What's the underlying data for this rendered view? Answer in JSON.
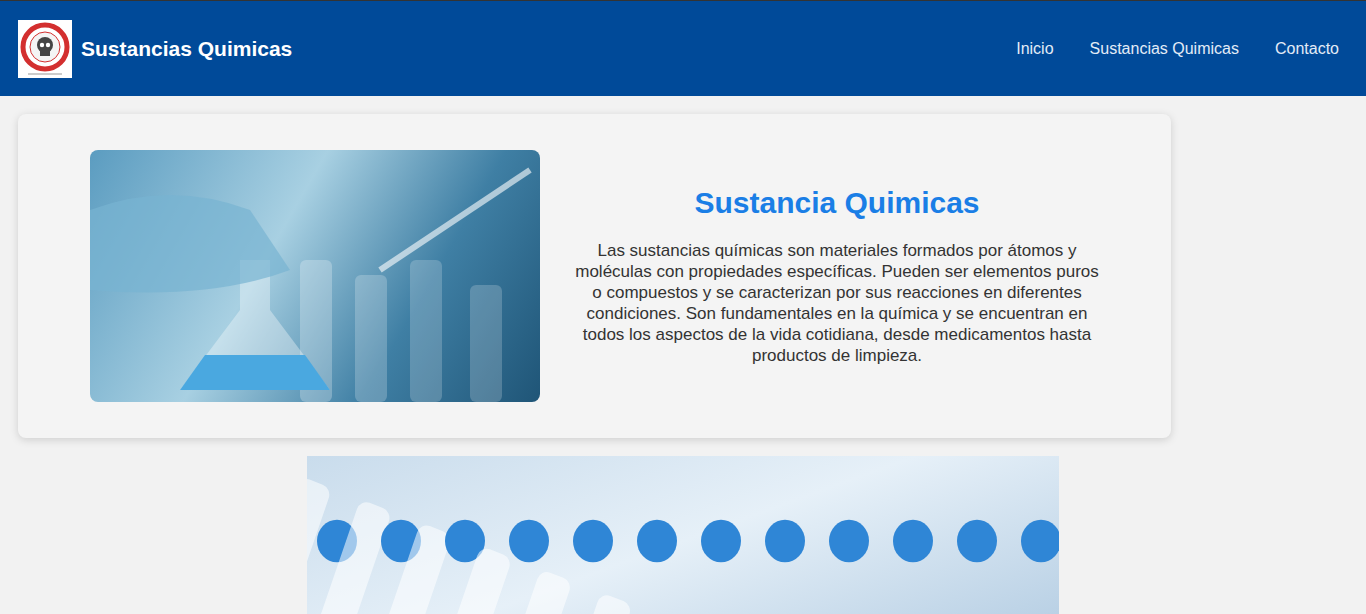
{
  "header": {
    "title": "Sustancias Quimicas",
    "nav": [
      "Inicio",
      "Sustancias Quimicas",
      "Contacto"
    ]
  },
  "hero": {
    "heading": "Sustancia Quimicas",
    "text": "Las sustancias químicas son materiales formados por átomos y moléculas con propiedades específicas. Pueden ser elementos puros o compuestos y se caracterizan por sus reacciones en diferentes condiciones. Son fundamentales en la química y se encuentran en todos los aspectos de la vida cotidiana, desde medicamentos hasta productos de limpieza."
  }
}
